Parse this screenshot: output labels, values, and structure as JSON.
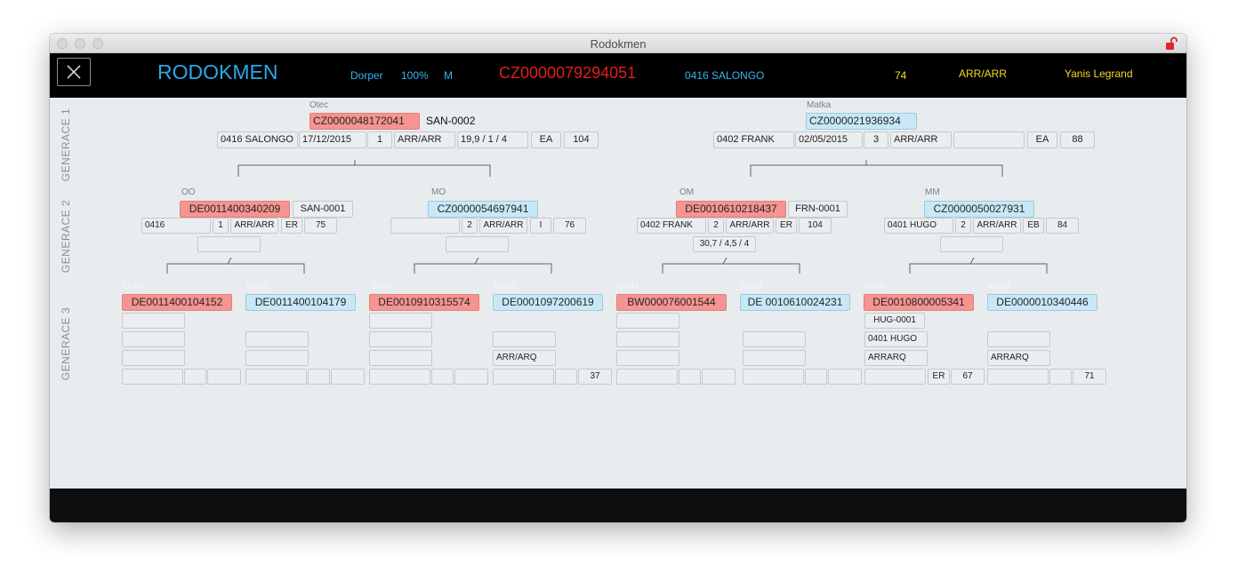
{
  "window": {
    "title": "Rodokmen"
  },
  "header": {
    "app_title": "RODOKMEN",
    "breed": "Dorper",
    "percent": "100%",
    "sex": "M",
    "animal_id": "CZ0000079294051",
    "farm": "0416 SALONGO",
    "score": "74",
    "genotype": "ARR/ARR",
    "user": "Yanis Legrand",
    "colors": {
      "title": "#2aa8e8",
      "id": "#e01e1e",
      "info_blue": "#3bb3ee",
      "info_yellow": "#f1dc27"
    }
  },
  "generations": {
    "g1": "GENERACE 1",
    "g2": "GENERACE 2",
    "g3": "GENERACE 3"
  },
  "gen1": {
    "father": {
      "label": "Otec",
      "id": "CZ0000048172041",
      "code": "SAN-0002",
      "farm": "0416 SALONGO",
      "date": "17/12/2015",
      "litter": "1",
      "genotype": "ARR/ARR",
      "measure": "19,9 / 1 / 4",
      "class": "EA",
      "score": "104"
    },
    "mother": {
      "label": "Matka",
      "id": "CZ0000021936934",
      "code": "",
      "farm": "0402 FRANK",
      "date": "02/05/2015",
      "litter": "3",
      "genotype": "ARR/ARR",
      "measure": "",
      "class": "EA",
      "score": "88"
    }
  },
  "gen2": {
    "oo": {
      "label": "OO",
      "id": "DE0011400340209",
      "code": "SAN-0001",
      "farm": "0416",
      "litter": "1",
      "genotype": "ARR/ARR",
      "class": "ER",
      "score": "75",
      "measure": ""
    },
    "mo": {
      "label": "MO",
      "id": "CZ0000054697941",
      "code": "",
      "farm": "",
      "litter": "2",
      "genotype": "ARR/ARR",
      "class": "I",
      "score": "76",
      "measure": ""
    },
    "om": {
      "label": "OM",
      "id": "DE0010610218437",
      "code": "FRN-0001",
      "farm": "0402 FRANK",
      "litter": "2",
      "genotype": "ARR/ARR",
      "class": "ER",
      "score": "104",
      "measure": "30,7 / 4,5 / 4"
    },
    "mm": {
      "label": "MM",
      "id": "CZ0000050027931",
      "code": "",
      "farm": "0401 HUGO",
      "litter": "2",
      "genotype": "ARR/ARR",
      "class": "EB",
      "score": "84",
      "measure": ""
    }
  },
  "gen3": {
    "ooo": {
      "label": "OOO",
      "id": "DE0011400104152",
      "code": "",
      "farm": "",
      "genotype": "",
      "class": "",
      "score": ""
    },
    "moo": {
      "label": "MOO",
      "id": "DE0011400104179",
      "code": "",
      "farm": "",
      "genotype": "",
      "class": "",
      "score": ""
    },
    "omo": {
      "label": "OMO",
      "id": "DE0010910315574",
      "code": "",
      "farm": "",
      "genotype": "",
      "class": "",
      "score": ""
    },
    "mmo": {
      "label": "MMO",
      "id": "DE0001097200619",
      "code": "",
      "farm": "",
      "genotype": "ARR/ARQ",
      "class": "",
      "score": "37"
    },
    "oom": {
      "label": "OOM",
      "id": "BW000076001544",
      "code": "",
      "farm": "",
      "genotype": "",
      "class": "",
      "score": ""
    },
    "mom": {
      "label": "MOM",
      "id": "DE 0010610024231",
      "code": "",
      "farm": "",
      "genotype": "",
      "class": "",
      "score": ""
    },
    "omm": {
      "label": "OMM",
      "id": "DE0010800005341",
      "code": "HUG-0001",
      "farm": "0401 HUGO",
      "genotype": "ARRARQ",
      "class": "ER",
      "score": "67"
    },
    "mmm": {
      "label": "MMM",
      "id": "DE0000010340446",
      "code": "",
      "farm": "",
      "genotype": "ARRARQ",
      "class": "",
      "score": "71"
    }
  },
  "icons": {
    "close": "close-icon",
    "lock": "lock-open-icon"
  }
}
